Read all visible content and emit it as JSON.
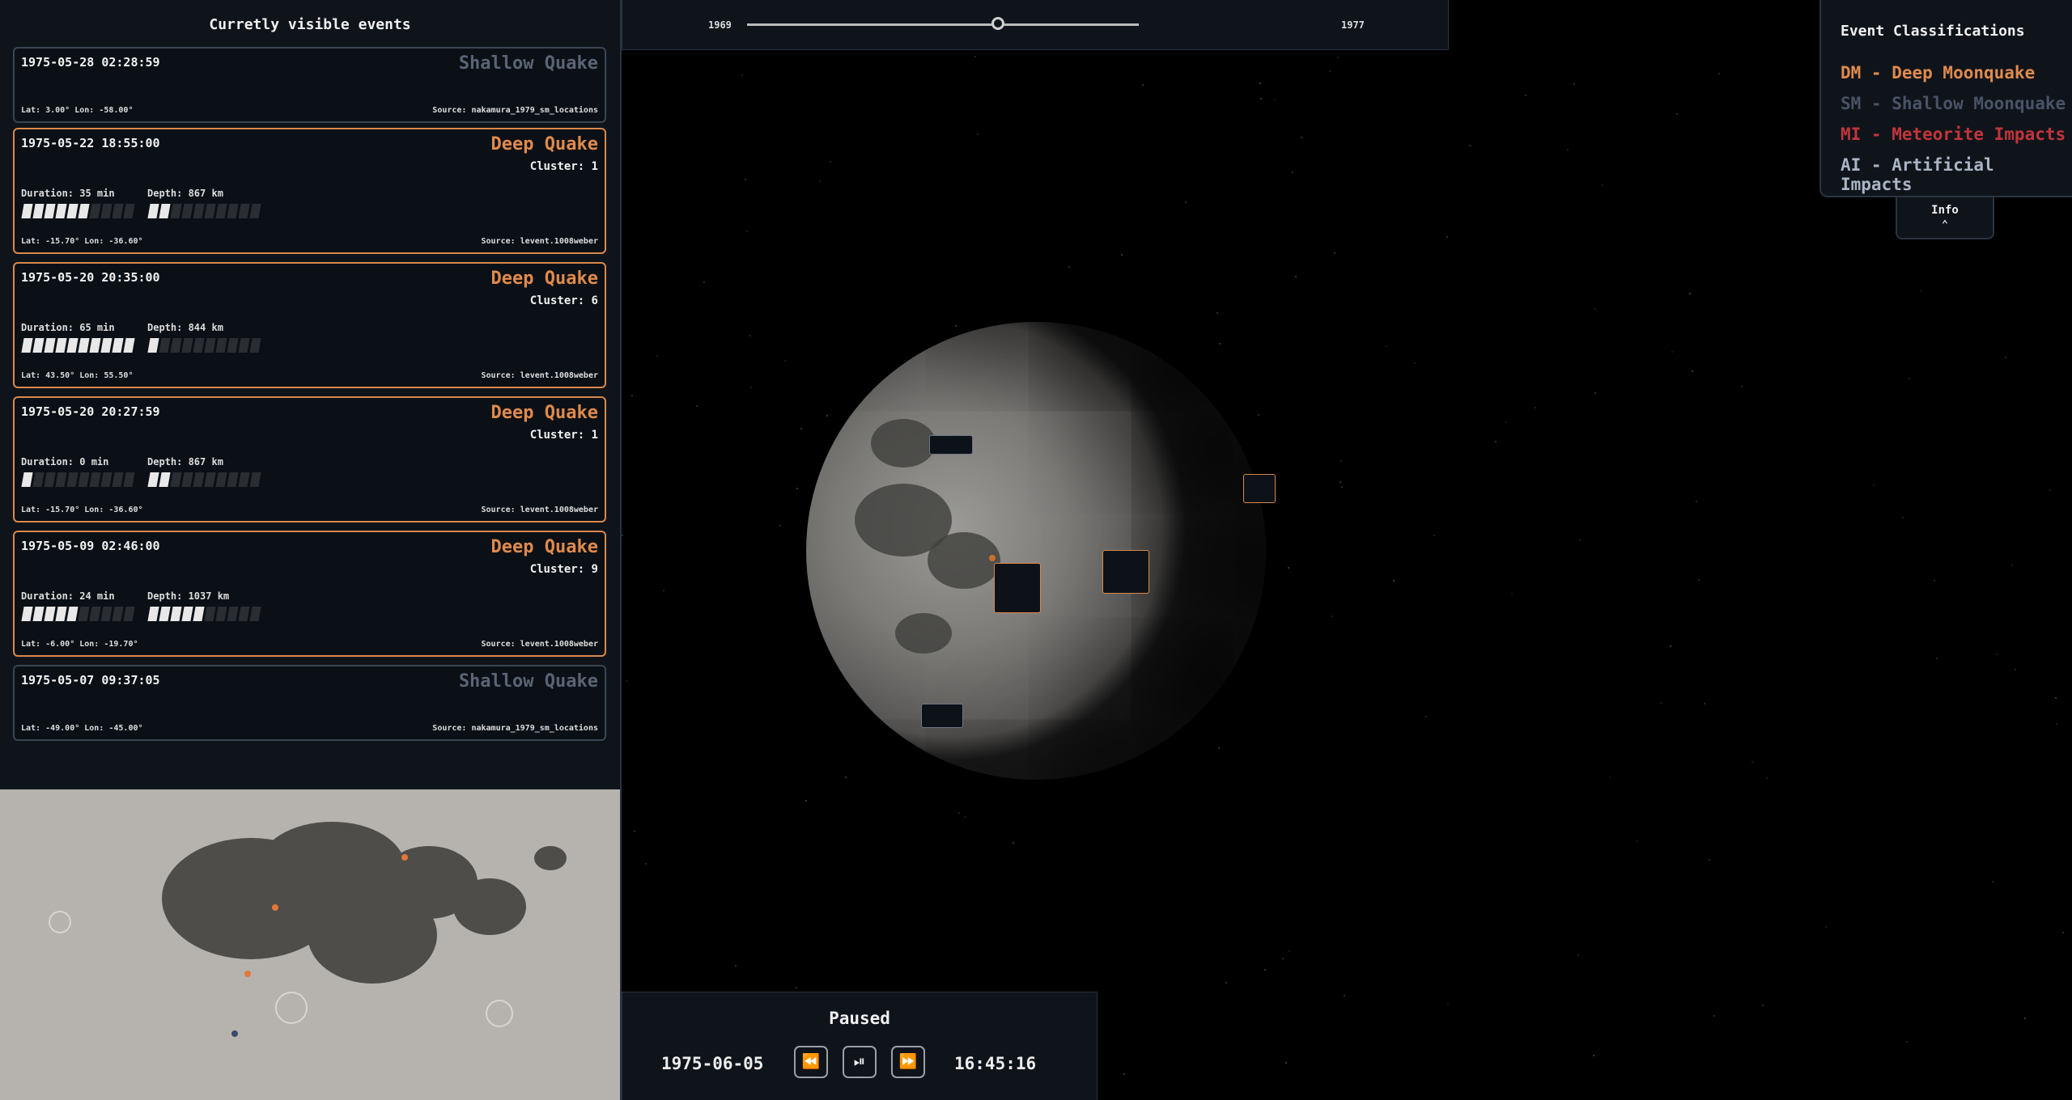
{
  "panel": {
    "title": "Curretly visible events"
  },
  "events": [
    {
      "date": "1975-05-28 02:28:59",
      "type": "Shallow Quake",
      "kind": "shallow",
      "cluster": "",
      "duration": "",
      "depth": "",
      "dur_bars": 0,
      "depth_bars": 0,
      "latlon": "Lat: 3.00° Lon: -58.00°",
      "source": "Source: nakamura_1979_sm_locations"
    },
    {
      "date": "1975-05-22 18:55:00",
      "type": "Deep Quake",
      "kind": "deep",
      "cluster": "Cluster: 1",
      "duration": "Duration: 35 min",
      "depth": "Depth: 867 km",
      "dur_bars": 6,
      "depth_bars": 2,
      "latlon": "Lat: -15.70° Lon: -36.60°",
      "source": "Source: levent.1008weber"
    },
    {
      "date": "1975-05-20 20:35:00",
      "type": "Deep Quake",
      "kind": "deep",
      "cluster": "Cluster: 6",
      "duration": "Duration: 65 min",
      "depth": "Depth: 844 km",
      "dur_bars": 10,
      "depth_bars": 1,
      "latlon": "Lat: 43.50° Lon: 55.50°",
      "source": "Source: levent.1008weber"
    },
    {
      "date": "1975-05-20 20:27:59",
      "type": "Deep Quake",
      "kind": "deep",
      "cluster": "Cluster: 1",
      "duration": "Duration: 0 min",
      "depth": "Depth: 867 km",
      "dur_bars": 1,
      "depth_bars": 2,
      "latlon": "Lat: -15.70° Lon: -36.60°",
      "source": "Source: levent.1008weber"
    },
    {
      "date": "1975-05-09 02:46:00",
      "type": "Deep Quake",
      "kind": "deep",
      "cluster": "Cluster: 9",
      "duration": "Duration: 24 min",
      "depth": "Depth: 1037 km",
      "dur_bars": 5,
      "depth_bars": 5,
      "latlon": "Lat: -6.00° Lon: -19.70°",
      "source": "Source: levent.1008weber"
    },
    {
      "date": "1975-05-07 09:37:05",
      "type": "Shallow Quake",
      "kind": "shallow",
      "cluster": "",
      "duration": "",
      "depth": "",
      "dur_bars": 0,
      "depth_bars": 0,
      "latlon": "Lat: -49.00° Lon: -45.00°",
      "source": "Source: nakamura_1979_sm_locations"
    }
  ],
  "timeline": {
    "start": "1969",
    "end": "1977",
    "position": 0.64
  },
  "legend": {
    "title": "Event Classifications",
    "items": [
      {
        "label": "DM - Deep Moonquake",
        "color": "#e08a4c"
      },
      {
        "label": "SM - Shallow Moonquake",
        "color": "#4a5366"
      },
      {
        "label": "MI - Meteorite Impacts",
        "color": "#c0353a"
      },
      {
        "label": "AI - Artificial Impacts",
        "color": "#aab4c4"
      }
    ],
    "info_label": "Info"
  },
  "playback": {
    "status": "Paused",
    "date": "1975-06-05",
    "time": "16:45:16"
  }
}
